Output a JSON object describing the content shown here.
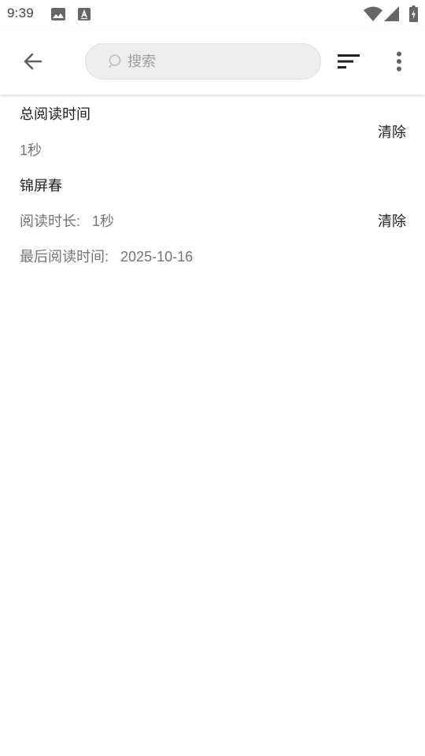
{
  "status_bar": {
    "time": "9:39",
    "icons": [
      "image-icon",
      "a-badge-icon",
      "wifi-icon",
      "signal-icon",
      "battery-charging-icon"
    ]
  },
  "toolbar": {
    "search_placeholder": "搜索",
    "icons": [
      "arrow-back-icon",
      "search-icon",
      "sort-icon",
      "more-vert-icon"
    ]
  },
  "total": {
    "title": "总阅读时间",
    "value": "1秒",
    "clear_label": "清除"
  },
  "books": [
    {
      "title": "锦屏春",
      "duration_label": "阅读时长:",
      "duration_value": "1秒",
      "last_read_label": "最后阅读时间:",
      "last_read_value": "2025-10-16",
      "clear_label": "清除"
    }
  ]
}
